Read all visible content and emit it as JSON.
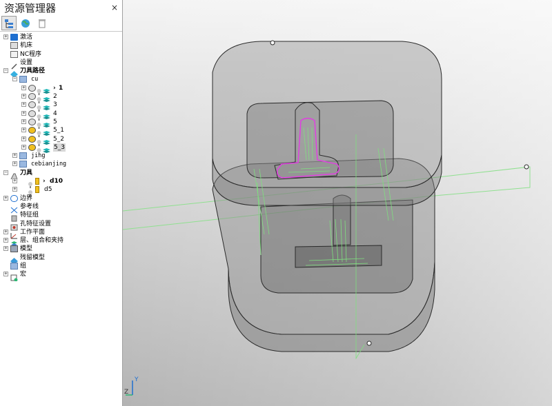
{
  "panel": {
    "title": "资源管理器",
    "close_glyph": "×"
  },
  "toolbar": {
    "buttons": [
      "explorer-tree-icon",
      "globe-icon",
      "delete-icon"
    ]
  },
  "tree": {
    "activation": "激活",
    "machine": "机床",
    "nc_program": "NC程序",
    "settings": "设置",
    "toolpaths": "刀具路径",
    "folder_cu": "cu",
    "paths": [
      "1",
      "2",
      "3",
      "4",
      "5",
      "5_1",
      "5_2",
      "5_3"
    ],
    "folder_jing": "jing",
    "folder_cebianjing": "cebianjing",
    "tools": "刀具",
    "tool_d10": "d10",
    "tool_d5": "d5",
    "boundary": "边界",
    "reference_line": "参考线",
    "feature_group": "特征组",
    "hole_feature": "孔特征设置",
    "workplane": "工作平面",
    "layers": "层、组合和夹持",
    "model": "模型",
    "stock_model": "残留模型",
    "group": "组",
    "macro": "宏"
  },
  "viewport": {
    "axis_y": "Y",
    "axis_z": "Z",
    "colors": {
      "bg_top": "#f4f4f4",
      "bg_bottom": "#b4b4b4",
      "solid": "#8c8c8c",
      "edge": "#2a2a2a",
      "toolpath": "#7fe07f",
      "selected_path": "#e040e0"
    }
  }
}
